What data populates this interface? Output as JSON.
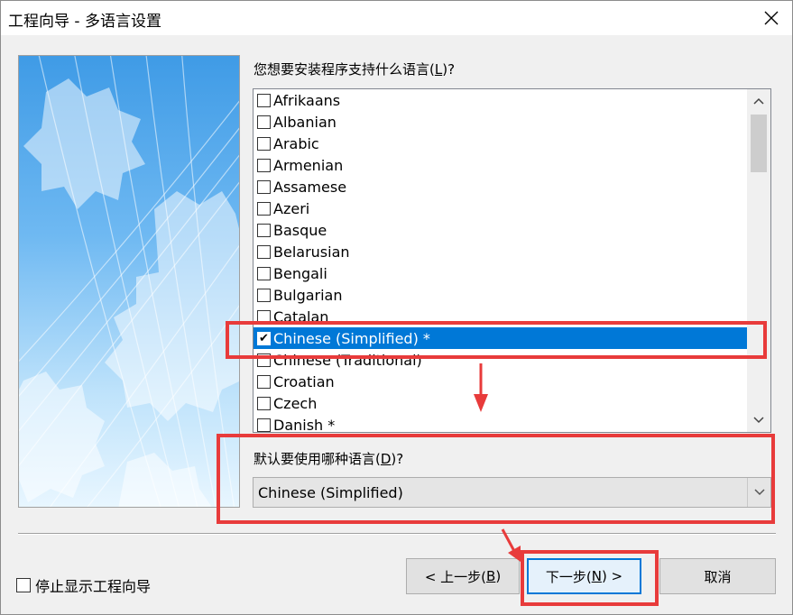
{
  "window": {
    "title": "工程向导 - 多语言设置",
    "close_label": "✕"
  },
  "main": {
    "question_text": "您想要安装程序支持什么语言(",
    "question_key": "L",
    "question_tail": ")?",
    "languages": [
      {
        "label": "Afrikaans",
        "checked": false,
        "selected": false
      },
      {
        "label": "Albanian",
        "checked": false,
        "selected": false
      },
      {
        "label": "Arabic",
        "checked": false,
        "selected": false
      },
      {
        "label": "Armenian",
        "checked": false,
        "selected": false
      },
      {
        "label": "Assamese",
        "checked": false,
        "selected": false
      },
      {
        "label": "Azeri",
        "checked": false,
        "selected": false
      },
      {
        "label": "Basque",
        "checked": false,
        "selected": false
      },
      {
        "label": "Belarusian",
        "checked": false,
        "selected": false
      },
      {
        "label": "Bengali",
        "checked": false,
        "selected": false
      },
      {
        "label": "Bulgarian",
        "checked": false,
        "selected": false
      },
      {
        "label": "Catalan",
        "checked": false,
        "selected": false
      },
      {
        "label": "Chinese (Simplified) *",
        "checked": true,
        "selected": true
      },
      {
        "label": "Chinese (Traditional)",
        "checked": false,
        "selected": false
      },
      {
        "label": "Croatian",
        "checked": false,
        "selected": false
      },
      {
        "label": "Czech",
        "checked": false,
        "selected": false
      },
      {
        "label": "Danish *",
        "checked": false,
        "selected": false
      }
    ],
    "default_label_text": "默认要使用哪种语言(",
    "default_label_key": "D",
    "default_label_tail": ")?",
    "default_value": "Chinese (Simplified)"
  },
  "footer": {
    "no_wizard_label": "停止显示工程向导",
    "no_wizard_checked": false,
    "back_button": {
      "pre": "< 上一步(",
      "key": "B",
      "post": ")"
    },
    "next_button": {
      "pre": "下一步(",
      "key": "N",
      "post": ") >"
    },
    "cancel_label": "取消"
  },
  "colors": {
    "highlight": "#e83b3b",
    "selection": "#0078d7"
  }
}
